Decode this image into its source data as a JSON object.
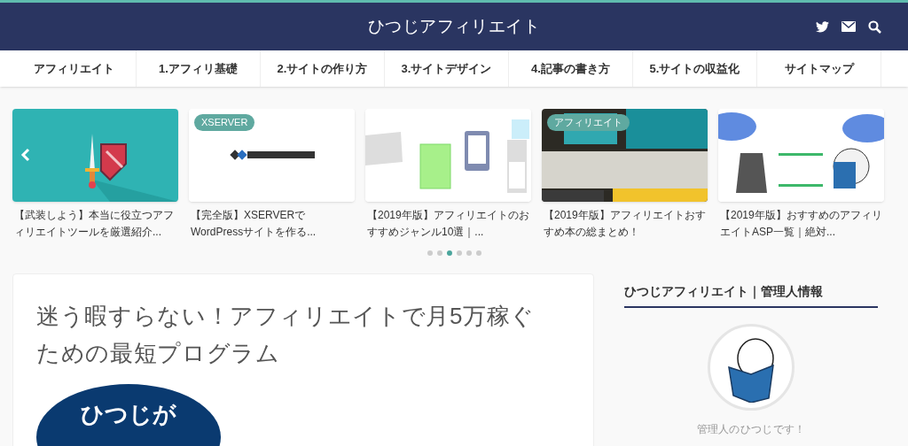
{
  "header": {
    "title": "ひつじアフィリエイト"
  },
  "nav": [
    "アフィリエイト",
    "1.アフィリ基礎",
    "2.サイトの作り方",
    "3.サイトデザイン",
    "4.記事の書き方",
    "5.サイトの収益化",
    "サイトマップ"
  ],
  "slides": [
    {
      "kind": "sword",
      "title": "【武装しよう】本当に役立つアフィリエイトツールを厳選紹介..."
    },
    {
      "kind": "logo",
      "tag": "XSERVER",
      "title": "【完全版】XSERVERでWordPressサイトを作る..."
    },
    {
      "kind": "devices",
      "title": "【2019年版】アフィリエイトのおすすめジャンル10選｜..."
    },
    {
      "kind": "books",
      "tag": "アフィリエイト",
      "title": "【2019年版】アフィリエイトおすすめ本の総まとめ！"
    },
    {
      "kind": "diagram",
      "title": "【2019年版】おすすめのアフィリエイトASP一覧｜絶対..."
    }
  ],
  "dots": [
    {
      "selected": false
    },
    {
      "selected": false
    },
    {
      "selected": true
    },
    {
      "selected": false
    },
    {
      "selected": false
    },
    {
      "selected": false
    }
  ],
  "article": {
    "title": "迷う暇すらない！アフィリエイトで月5万稼ぐための最短プログラム",
    "banner_text": "ひつじが"
  },
  "sidebar": {
    "heading": "ひつじアフィリエイト｜管理人情報",
    "caption": "管理人のひつじです！"
  }
}
